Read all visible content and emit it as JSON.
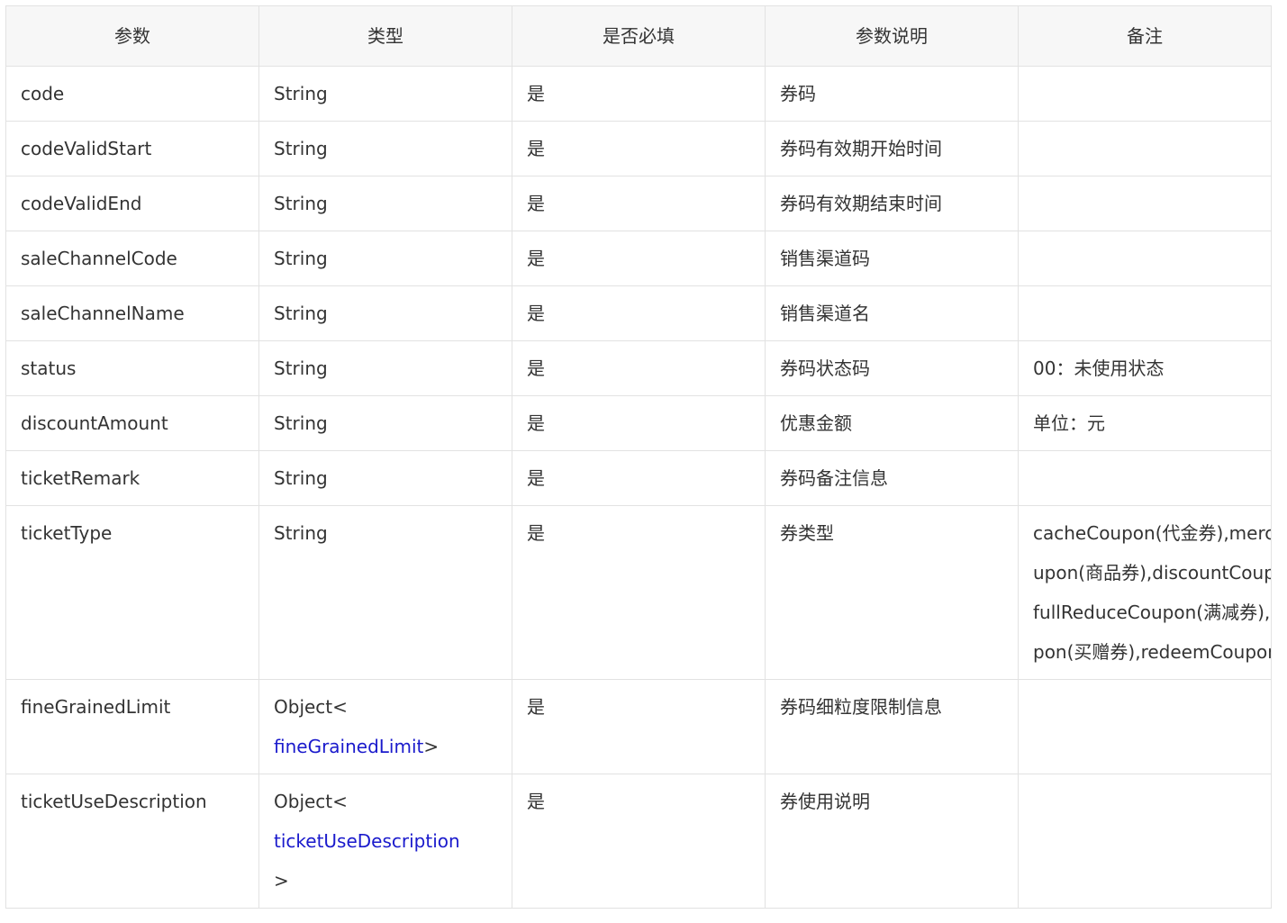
{
  "headers": [
    "参数",
    "类型",
    "是否必填",
    "参数说明",
    "备注"
  ],
  "rows": [
    {
      "name": "code",
      "type": "String",
      "required": "是",
      "desc": "券码",
      "remark": ""
    },
    {
      "name": "codeValidStart",
      "type": "String",
      "required": "是",
      "desc": "券码有效期开始时间",
      "remark": ""
    },
    {
      "name": "codeValidEnd",
      "type": "String",
      "required": "是",
      "desc": "券码有效期结束时间",
      "remark": ""
    },
    {
      "name": "saleChannelCode",
      "type": "String",
      "required": "是",
      "desc": "销售渠道码",
      "remark": ""
    },
    {
      "name": "saleChannelName",
      "type": "String",
      "required": "是",
      "desc": "销售渠道名",
      "remark": ""
    },
    {
      "name": "status",
      "type": "String",
      "required": "是",
      "desc": "券码状态码",
      "remark": "00：未使用状态"
    },
    {
      "name": "discountAmount",
      "type": "String",
      "required": "是",
      "desc": "优惠金额",
      "remark": "单位：元"
    },
    {
      "name": "ticketRemark",
      "type": "String",
      "required": "是",
      "desc": "券码备注信息",
      "remark": ""
    },
    {
      "name": "ticketType",
      "type": "String",
      "required": "是",
      "desc": "券类型",
      "remark": "cacheCoupon(代金券),merchandiseCoupon(商品券),discountCoupon(折扣券),fullReduceCoupon(满减券),buyGetCoupon(买赠券),redeemCoupon(兑换券)"
    },
    {
      "name": "fineGrainedLimit",
      "type_prefix": "Object<",
      "type_link": "fineGrainedLimit",
      "type_suffix": ">",
      "required": "是",
      "desc": "券码细粒度限制信息",
      "remark": ""
    },
    {
      "name": "ticketUseDescription",
      "type_prefix": "Object<",
      "type_link": "ticketUseDescription",
      "type_suffix": ">",
      "required": "是",
      "desc": "券使用说明"
    }
  ]
}
